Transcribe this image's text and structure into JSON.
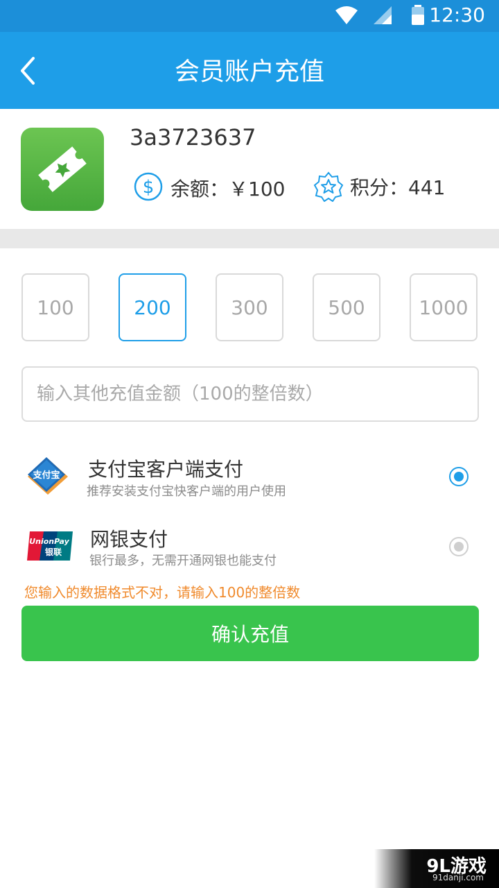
{
  "status_bar": {
    "time": "12:30",
    "icons": [
      "wifi-icon",
      "signal-icon",
      "battery-icon"
    ]
  },
  "header": {
    "title": "会员账户充值",
    "back_icon": "chevron-left-icon"
  },
  "account": {
    "id": "3a3723637",
    "balance_text": "余额：￥100",
    "points_text": "积分：441",
    "app_icon": "ticket-icon"
  },
  "amounts": {
    "options": [
      "100",
      "200",
      "300",
      "500",
      "1000"
    ],
    "selected": "200"
  },
  "custom_amount": {
    "placeholder": "输入其他充值金额（100的整倍数）",
    "value": ""
  },
  "payment": {
    "alipay": {
      "title": "支付宝客户端支付",
      "subtitle": "推荐安装支付宝快客户端的用户使用",
      "logo_text": "支付宝",
      "selected": true
    },
    "unionpay": {
      "title": "网银支付",
      "subtitle": "银行最多，无需开通网银也能支付",
      "logo_text": "UnionPay",
      "logo_cn": "银联",
      "selected": false
    }
  },
  "error_message": "您输入的数据格式不对，请输入100的整倍数",
  "confirm_label": "确认充值",
  "watermark": {
    "logo": "9L游戏",
    "url": "91danji.com"
  },
  "colors": {
    "accent": "#1e9ee8",
    "confirm": "#39c44d",
    "error": "#f08a2c"
  }
}
